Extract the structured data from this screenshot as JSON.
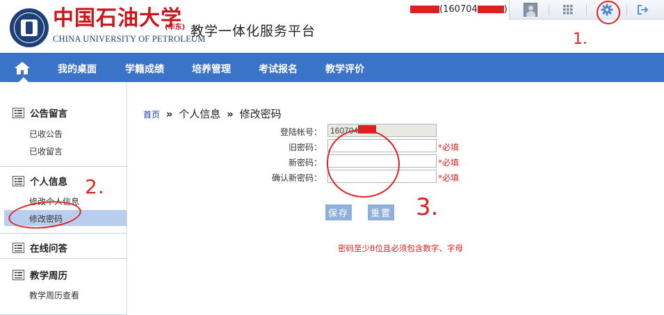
{
  "header": {
    "logo_cn": "中国石油大学",
    "logo_sub": "(华东)",
    "logo_en": "CHINA UNIVERSITY OF PETROLEUM",
    "platform_title": "教学一体化服务平台",
    "user_open": "(160704",
    "user_close": ")"
  },
  "toolbar": {
    "avatar_icon": "user-avatar-icon",
    "grid_icon": "app-grid-icon",
    "settings_icon": "gear-icon",
    "logout_icon": "logout-icon"
  },
  "nav": {
    "items": [
      "我的桌面",
      "学籍成绩",
      "培养管理",
      "考试报名",
      "教学评价"
    ]
  },
  "sidebar": {
    "groups": [
      {
        "title": "公告留言",
        "links": [
          "已收公告",
          "已收留言"
        ]
      },
      {
        "title": "个人信息",
        "links": [
          "修改个人信息",
          "修改密码"
        ]
      },
      {
        "title": "在线问答",
        "links": []
      },
      {
        "title": "教学周历",
        "links": [
          "教学周历查看"
        ]
      }
    ]
  },
  "breadcrumb": {
    "home": "首页",
    "sep": "»",
    "parent": "个人信息",
    "current": "修改密码"
  },
  "form": {
    "login_label": "登陆帐号：",
    "login_value": "160704",
    "old_label": "旧密码：",
    "new_label": "新密码：",
    "confirm_label": "确认新密码：",
    "required": "*必填",
    "save": "保存",
    "reset": "重置",
    "hint": "密码至少8位且必须包含数字、字母"
  },
  "annotations": {
    "one": "1.",
    "two": "2.",
    "three": "3."
  },
  "colors": {
    "nav_bg": "#3a73c7",
    "accent_red": "#e02020",
    "button_bg": "#8fb0db",
    "active_item_bg": "#b9cdee"
  }
}
